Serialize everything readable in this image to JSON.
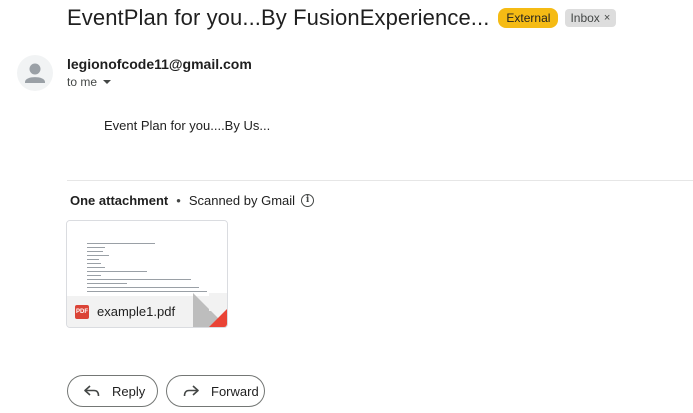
{
  "email": {
    "subject": "EventPlan for you...By FusionExperience...",
    "labels": {
      "external": "External",
      "inbox": "Inbox",
      "inbox_remove": "×"
    },
    "sender": {
      "email": "legionofcode11@gmail.com",
      "recipient": "to me"
    },
    "body": "Event Plan for you....By Us..."
  },
  "attachments": {
    "count_label": "One attachment",
    "separator": "•",
    "scanned_label": "Scanned by Gmail",
    "info_glyph": "i",
    "files": [
      {
        "name": "example1.pdf",
        "type_label": "PDF",
        "icon": "pdf-icon"
      }
    ]
  },
  "actions": {
    "reply_label": "Reply",
    "forward_label": "Forward"
  },
  "colors": {
    "external_badge": "#f5bb14",
    "inbox_badge": "#dddddd",
    "pdf_red": "#db4437"
  }
}
